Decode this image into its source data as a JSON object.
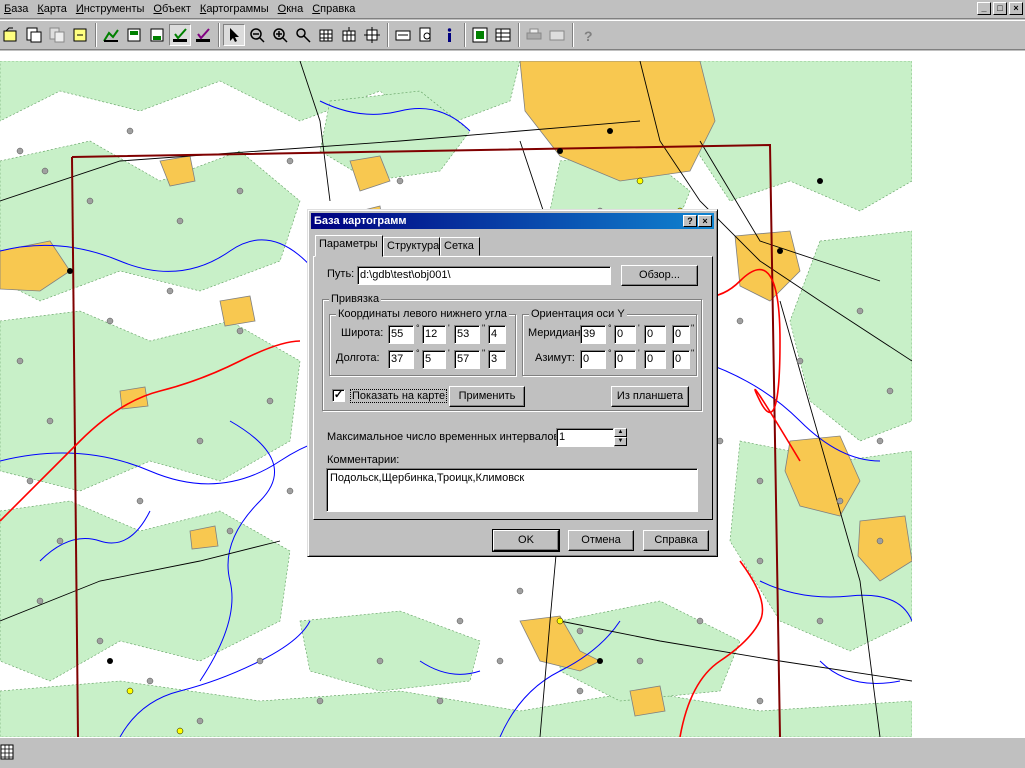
{
  "menu": [
    "База",
    "Карта",
    "Инструменты",
    "Объект",
    "Картограммы",
    "Окна",
    "Справка"
  ],
  "menu_underline": [
    "Б",
    "К",
    "И",
    "О",
    "К",
    "О",
    "С"
  ],
  "mdi_buttons": [
    "_",
    "□",
    "×"
  ],
  "toolbar_icons": [
    "open-db-icon",
    "save-db-icon",
    "copy-icon",
    "export-icon",
    "layer-icon",
    "layer-save-icon",
    "layer-edit-icon",
    "layer-check-icon",
    "layer-check2-icon",
    "pointer-icon",
    "zoom-out-icon",
    "zoom-in-icon",
    "zoom-fit-icon",
    "grid-icon",
    "grid-add-icon",
    "crosshair-icon",
    "label-icon",
    "find-icon",
    "info-icon",
    "calc-icon",
    "table-icon",
    "print-icon",
    "print-setup-icon",
    "help-icon"
  ],
  "dialog": {
    "title": "База картограмм",
    "help_btn": "?",
    "close_btn": "×",
    "tabs": [
      "Параметры",
      "Структура",
      "Сетка"
    ],
    "path_label": "Путь:",
    "path_value": "d:\\gdb\\test\\obj001\\",
    "browse_button": "Обзор...",
    "binding_group": "Привязка",
    "corner_group": "Координаты левого нижнего угла",
    "orientation_group": "Ориентация оси Y",
    "latitude_label": "Широта:",
    "latitude": [
      "55",
      "12",
      "53",
      "4"
    ],
    "longitude_label": "Долгота:",
    "longitude": [
      "37",
      "5",
      "57",
      "3"
    ],
    "meridian_label": "Меридиан:",
    "meridian": [
      "39",
      "0",
      "0",
      "0"
    ],
    "azimuth_label": "Азимут:",
    "azimuth": [
      "0",
      "0",
      "0",
      "0"
    ],
    "deg_marks": [
      "°",
      "'",
      "\"",
      "\""
    ],
    "show_on_map": "Показать на карте",
    "show_checked": "✓",
    "apply_button": "Применить",
    "from_tablet_button": "Из планшета",
    "max_intervals_label": "Максимальное число временных интервалов:",
    "max_intervals_value": "1",
    "comments_label": "Комментарии:",
    "comments_value": "Подольск,Щербинка,Троицк,Климовск",
    "ok_button": "OK",
    "cancel_button": "Отмена",
    "help_button": "Справка"
  },
  "colors": {
    "forest": "#c8f0c8",
    "urban": "#f8c850",
    "river": "#0000ff",
    "road": "#000000",
    "border": "#ff0000",
    "frame": "#800000"
  }
}
